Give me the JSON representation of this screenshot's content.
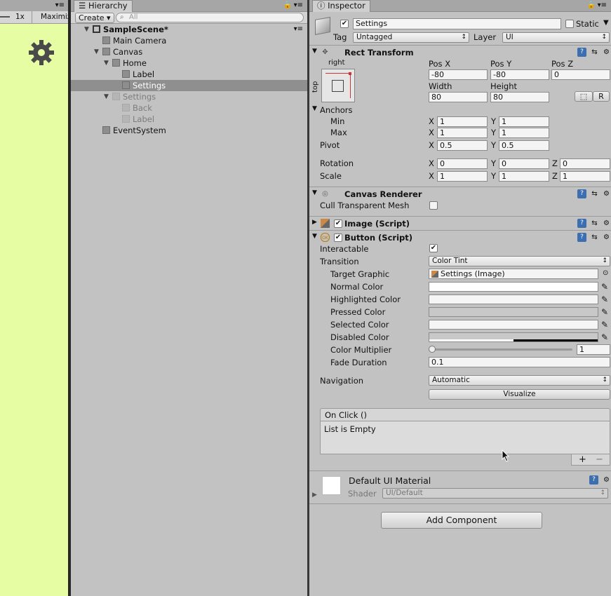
{
  "game": {
    "scale_label": "1x",
    "maximize_label": "Maximiz",
    "icon": "gear-icon",
    "bg_color": "#e6fda3"
  },
  "hierarchy": {
    "tab_label": "Hierarchy",
    "create_label": "Create",
    "search_placeholder": "All",
    "items": [
      {
        "label": "SampleScene*",
        "depth": 0,
        "expanded": true,
        "bold": true
      },
      {
        "label": "Main Camera",
        "depth": 1,
        "expanded": null
      },
      {
        "label": "Canvas",
        "depth": 1,
        "expanded": true
      },
      {
        "label": "Home",
        "depth": 2,
        "expanded": true
      },
      {
        "label": "Label",
        "depth": 3,
        "expanded": null
      },
      {
        "label": "Settings",
        "depth": 3,
        "expanded": null,
        "selected": true
      },
      {
        "label": "Settings",
        "depth": 2,
        "expanded": true,
        "inactive": true
      },
      {
        "label": "Back",
        "depth": 3,
        "expanded": null,
        "inactive": true
      },
      {
        "label": "Label",
        "depth": 3,
        "expanded": null,
        "inactive": true
      },
      {
        "label": "EventSystem",
        "depth": 1,
        "expanded": null
      }
    ]
  },
  "inspector": {
    "tab_label": "Inspector",
    "object_name": "Settings",
    "static_label": "Static",
    "tag_label": "Tag",
    "tag_value": "Untagged",
    "layer_label": "Layer",
    "layer_value": "UI",
    "rect_transform": {
      "title": "Rect Transform",
      "anchor_x_label": "right",
      "anchor_y_label": "top",
      "pos_x_label": "Pos X",
      "pos_x": "-80",
      "pos_y_label": "Pos Y",
      "pos_y": "-80",
      "pos_z_label": "Pos Z",
      "pos_z": "0",
      "width_label": "Width",
      "width": "80",
      "height_label": "Height",
      "height": "80",
      "r_label": "R",
      "anchors_label": "Anchors",
      "min_label": "Min",
      "min_x": "1",
      "min_y": "1",
      "max_label": "Max",
      "max_x": "1",
      "max_y": "1",
      "pivot_label": "Pivot",
      "pivot_x": "0.5",
      "pivot_y": "0.5",
      "rotation_label": "Rotation",
      "rot_x": "0",
      "rot_y": "0",
      "rot_z": "0",
      "scale_label": "Scale",
      "scale_x": "1",
      "scale_y": "1",
      "scale_z": "1",
      "x": "X",
      "y": "Y",
      "z": "Z"
    },
    "canvas_renderer": {
      "title": "Canvas Renderer",
      "cull_label": "Cull Transparent Mesh"
    },
    "image": {
      "title": "Image (Script)"
    },
    "button": {
      "title": "Button (Script)",
      "interactable_label": "Interactable",
      "transition_label": "Transition",
      "transition_value": "Color Tint",
      "target_graphic_label": "Target Graphic",
      "target_graphic_value": "Settings (Image)",
      "normal_color_label": "Normal Color",
      "highlighted_color_label": "Highlighted Color",
      "pressed_color_label": "Pressed Color",
      "selected_color_label": "Selected Color",
      "disabled_color_label": "Disabled Color",
      "color_multiplier_label": "Color Multiplier",
      "color_multiplier": "1",
      "fade_duration_label": "Fade Duration",
      "fade_duration": "0.1",
      "navigation_label": "Navigation",
      "navigation_value": "Automatic",
      "visualize_label": "Visualize",
      "on_click_label": "On Click ()",
      "list_empty_label": "List is Empty",
      "add_label": "+",
      "remove_label": "−"
    },
    "material": {
      "name": "Default UI Material",
      "shader_label": "Shader",
      "shader_value": "UI/Default"
    },
    "add_component_label": "Add Component"
  }
}
